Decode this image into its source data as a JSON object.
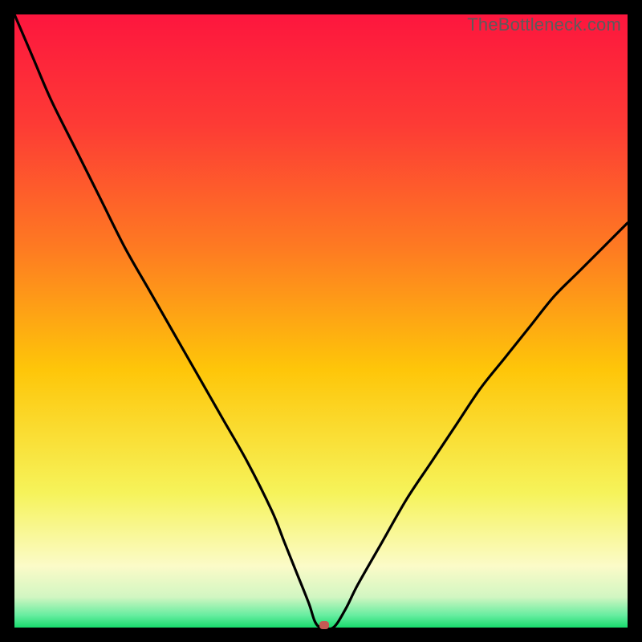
{
  "watermark": "TheBottleneck.com",
  "colors": {
    "top": "#fd163e",
    "upper": "#fe5d2d",
    "mid": "#fec409",
    "lower": "#f8f673",
    "pale": "#fdfde1",
    "green": "#2be57b",
    "curve": "#000000",
    "marker": "#c65a54",
    "frame": "#000000"
  },
  "chart_data": {
    "type": "line",
    "title": "",
    "xlabel": "",
    "ylabel": "",
    "xlim": [
      0,
      100
    ],
    "ylim": [
      0,
      100
    ],
    "x": [
      0,
      3,
      6,
      10,
      14,
      18,
      22,
      26,
      30,
      34,
      38,
      42,
      44,
      46,
      48,
      49,
      50,
      52,
      54,
      56,
      60,
      64,
      68,
      72,
      76,
      80,
      84,
      88,
      92,
      96,
      100
    ],
    "values": [
      100,
      93,
      86,
      78,
      70,
      62,
      55,
      48,
      41,
      34,
      27,
      19,
      14,
      9,
      4,
      1,
      0,
      0,
      3,
      7,
      14,
      21,
      27,
      33,
      39,
      44,
      49,
      54,
      58,
      62,
      66
    ],
    "marker": {
      "x": 50.5,
      "y": 0
    },
    "note": "V-shaped bottleneck curve; minimum near x≈50 at y≈0. Values estimated from image."
  }
}
